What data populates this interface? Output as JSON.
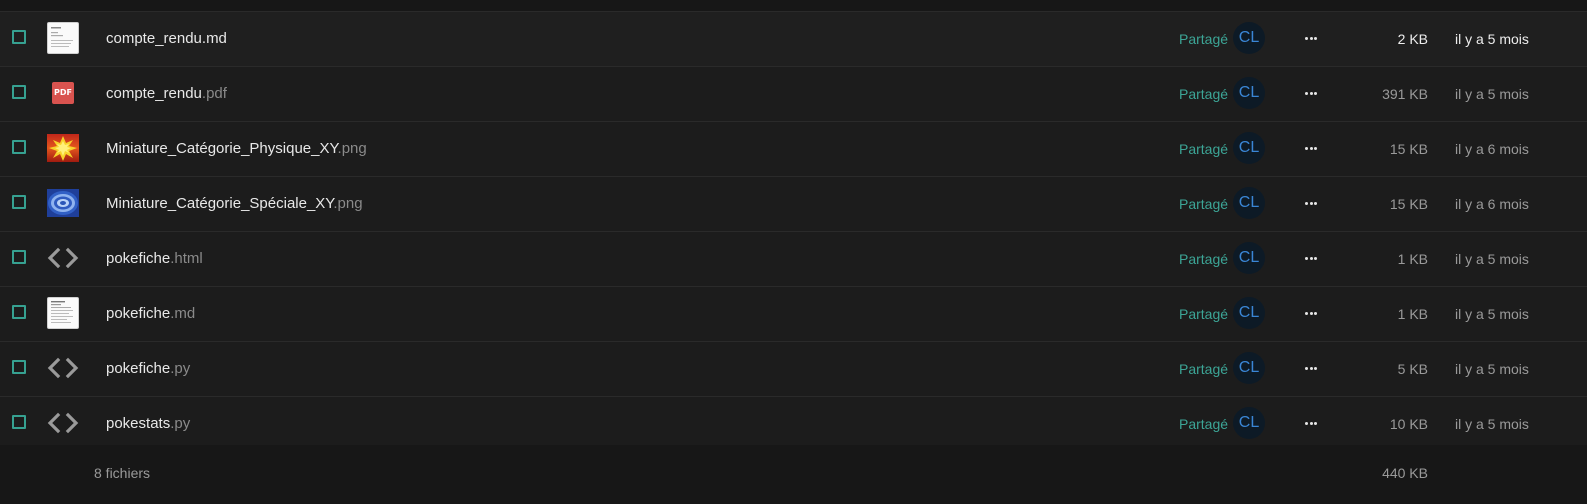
{
  "files": [
    {
      "base": "compte_rendu.md",
      "ext": "",
      "icon": "markdown-thumbnail-icon",
      "share": "Partagé",
      "avatar": "CL",
      "size": "2 KB",
      "modified": "il y a 5 mois"
    },
    {
      "base": "compte_rendu",
      "ext": ".pdf",
      "icon": "pdf-icon",
      "share": "Partagé",
      "avatar": "CL",
      "size": "391 KB",
      "modified": "il y a 5 mois"
    },
    {
      "base": "Miniature_Catégorie_Physique_XY",
      "ext": ".png",
      "icon": "image-physique-thumbnail-icon",
      "share": "Partagé",
      "avatar": "CL",
      "size": "15 KB",
      "modified": "il y a 6 mois"
    },
    {
      "base": "Miniature_Catégorie_Spéciale_XY",
      "ext": ".png",
      "icon": "image-speciale-thumbnail-icon",
      "share": "Partagé",
      "avatar": "CL",
      "size": "15 KB",
      "modified": "il y a 6 mois"
    },
    {
      "base": "pokefiche",
      "ext": ".html",
      "icon": "code-icon",
      "share": "Partagé",
      "avatar": "CL",
      "size": "1 KB",
      "modified": "il y a 5 mois"
    },
    {
      "base": "pokefiche",
      "ext": ".md",
      "icon": "markdown-thumbnail-icon",
      "share": "Partagé",
      "avatar": "CL",
      "size": "1 KB",
      "modified": "il y a 5 mois"
    },
    {
      "base": "pokefiche",
      "ext": ".py",
      "icon": "code-icon",
      "share": "Partagé",
      "avatar": "CL",
      "size": "5 KB",
      "modified": "il y a 5 mois"
    },
    {
      "base": "pokestats",
      "ext": ".py",
      "icon": "code-icon",
      "share": "Partagé",
      "avatar": "CL",
      "size": "10 KB",
      "modified": "il y a 5 mois"
    }
  ],
  "footer": {
    "count": "8 fichiers",
    "total": "440 KB"
  },
  "colors": {
    "accent": "#36a191",
    "avatar_text": "#3a86d6",
    "pdf": "#d9534f"
  }
}
